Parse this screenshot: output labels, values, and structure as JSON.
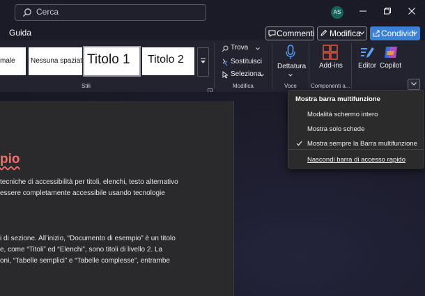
{
  "titlebar": {
    "search_placeholder": "Cerca",
    "avatar_initials": "AS"
  },
  "menubar": {
    "help_label": "Guida",
    "comments_label": "Commenti",
    "edit_label": "Modifica",
    "share_label": "Condividi"
  },
  "ribbon": {
    "styles": [
      {
        "label": "male"
      },
      {
        "label": "Nessuna spaziat"
      },
      {
        "label": "Titolo 1"
      },
      {
        "label": "Titolo 2"
      }
    ],
    "styles_group_label": "Stili",
    "editing": {
      "find_label": "Trova",
      "replace_label": "Sostituisci",
      "select_label": "Seleziona",
      "group_label": "Modifica"
    },
    "voice": {
      "dictate_label": "Dettatura",
      "group_label": "Voce"
    },
    "addins": {
      "label": "Add-ins",
      "group_label": "Componenti a..."
    },
    "editor_label": "Editor",
    "copilot_label": "Copilot"
  },
  "ribbon_menu": {
    "title": "Mostra barra multifunzione",
    "items": [
      {
        "label": "Modalità schermo intero",
        "checked": false
      },
      {
        "label": "Mostra solo schede",
        "checked": false
      },
      {
        "label": "Mostra sempre la Barra multifunzione",
        "checked": true
      },
      {
        "label": "Nascondi barra di accesso rapido",
        "checked": false
      }
    ]
  },
  "document": {
    "heading_fragment": "pio",
    "lines": [
      "tecniche di accessibilità per titoli, elenchi, testo alternativo",
      "essere completamente accessibile usando tecnologie",
      "i di sezione. All’inizio, “Documento di esempio” è un titolo",
      "e, come “Titoli” ed “Elenchi”, sono titoli di livello 2. La",
      "oni, “Tabelle semplici” e “Tabelle complesse”, entrambe"
    ]
  }
}
